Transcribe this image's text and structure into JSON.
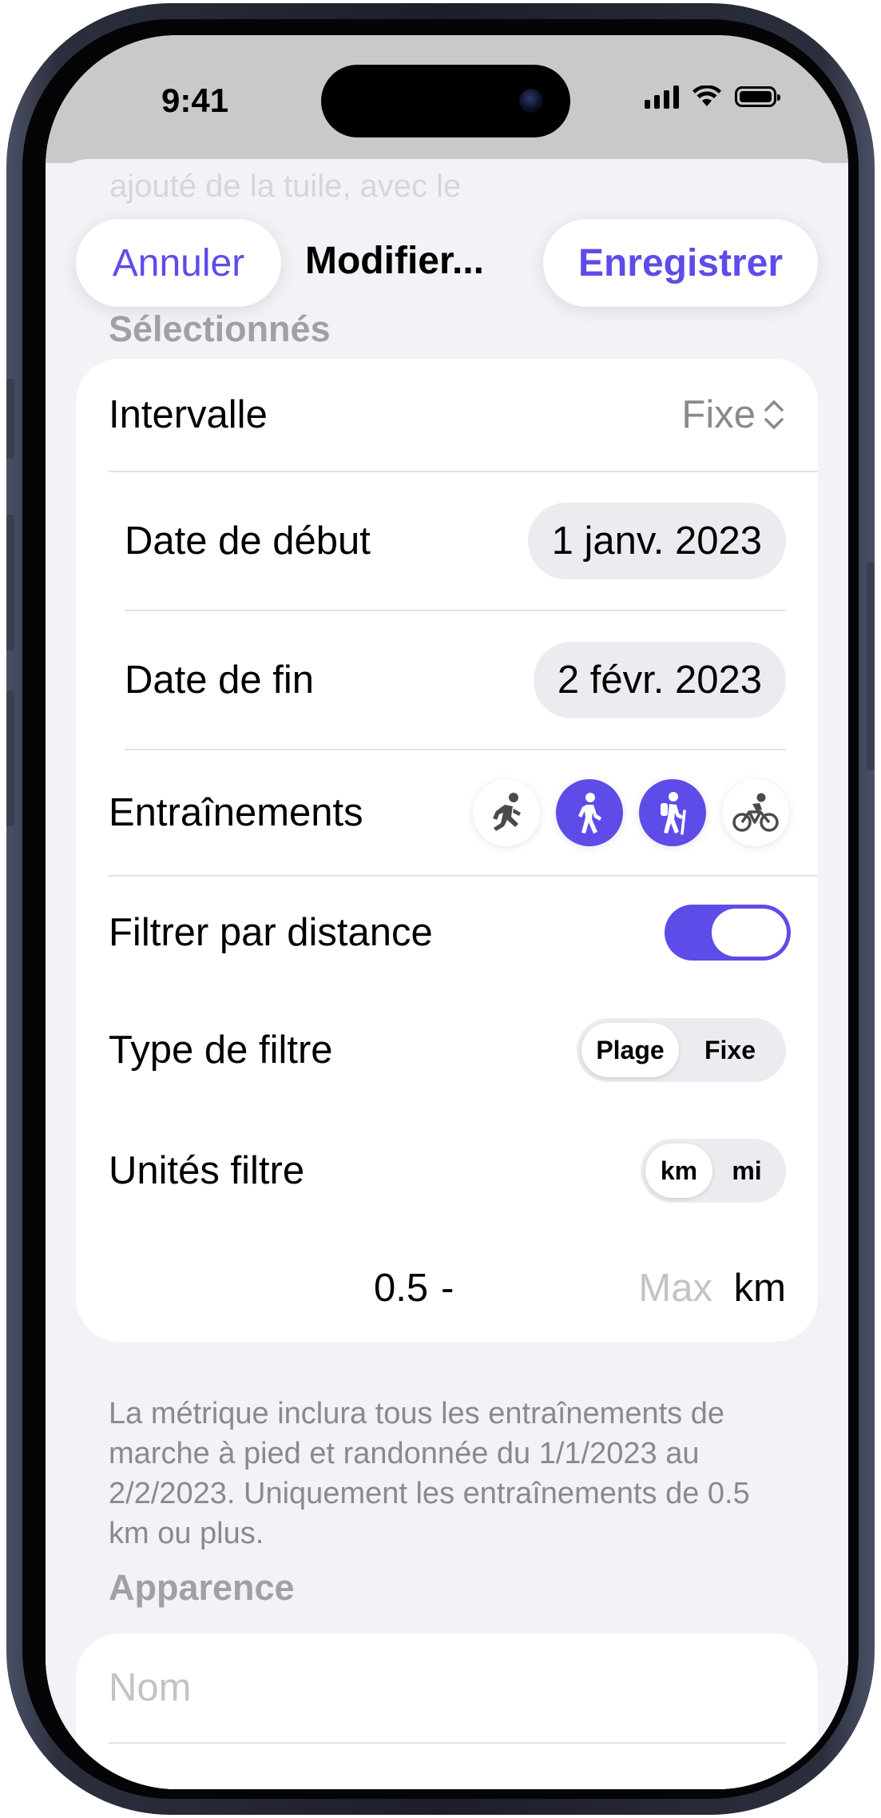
{
  "status_bar": {
    "time": "9:41"
  },
  "nav": {
    "cancel_label": "Annuler",
    "title": "Modifier...",
    "save_label": "Enregistrer",
    "accent_color": "#5e4ce8"
  },
  "background_hint": "ajouté de la tuile, avec le",
  "selection": {
    "header": "Sélectionnés",
    "interval": {
      "label": "Intervalle",
      "value": "Fixe",
      "icon": "chevron-up-down-icon"
    },
    "start_date": {
      "label": "Date de début",
      "value": "1 janv. 2023"
    },
    "end_date": {
      "label": "Date de fin",
      "value": "2 févr. 2023"
    },
    "workouts": {
      "label": "Entraînements",
      "items": [
        {
          "icon": "running-icon",
          "selected": false
        },
        {
          "icon": "walking-icon",
          "selected": true
        },
        {
          "icon": "hiking-icon",
          "selected": true
        },
        {
          "icon": "cycling-icon",
          "selected": false
        }
      ]
    },
    "distance_filter": {
      "label": "Filtrer par distance",
      "enabled": true
    },
    "filter_type": {
      "label": "Type de filtre",
      "options": [
        "Plage",
        "Fixe"
      ],
      "selected": "Plage"
    },
    "filter_units": {
      "label": "Unités filtre",
      "options": [
        "km",
        "mi"
      ],
      "selected": "km"
    },
    "range": {
      "min": "0.5",
      "separator": "-",
      "max_placeholder": "Max",
      "unit": "km"
    },
    "footer": "La métrique inclura tous les entraînements de marche à pied et randonnée du 1/1/2023 au 2/2/2023. Uniquement les entraînements de 0.5 km ou plus."
  },
  "appearance": {
    "header": "Apparence",
    "name_placeholder": "Nom",
    "color_ring": "#b4d33c"
  }
}
